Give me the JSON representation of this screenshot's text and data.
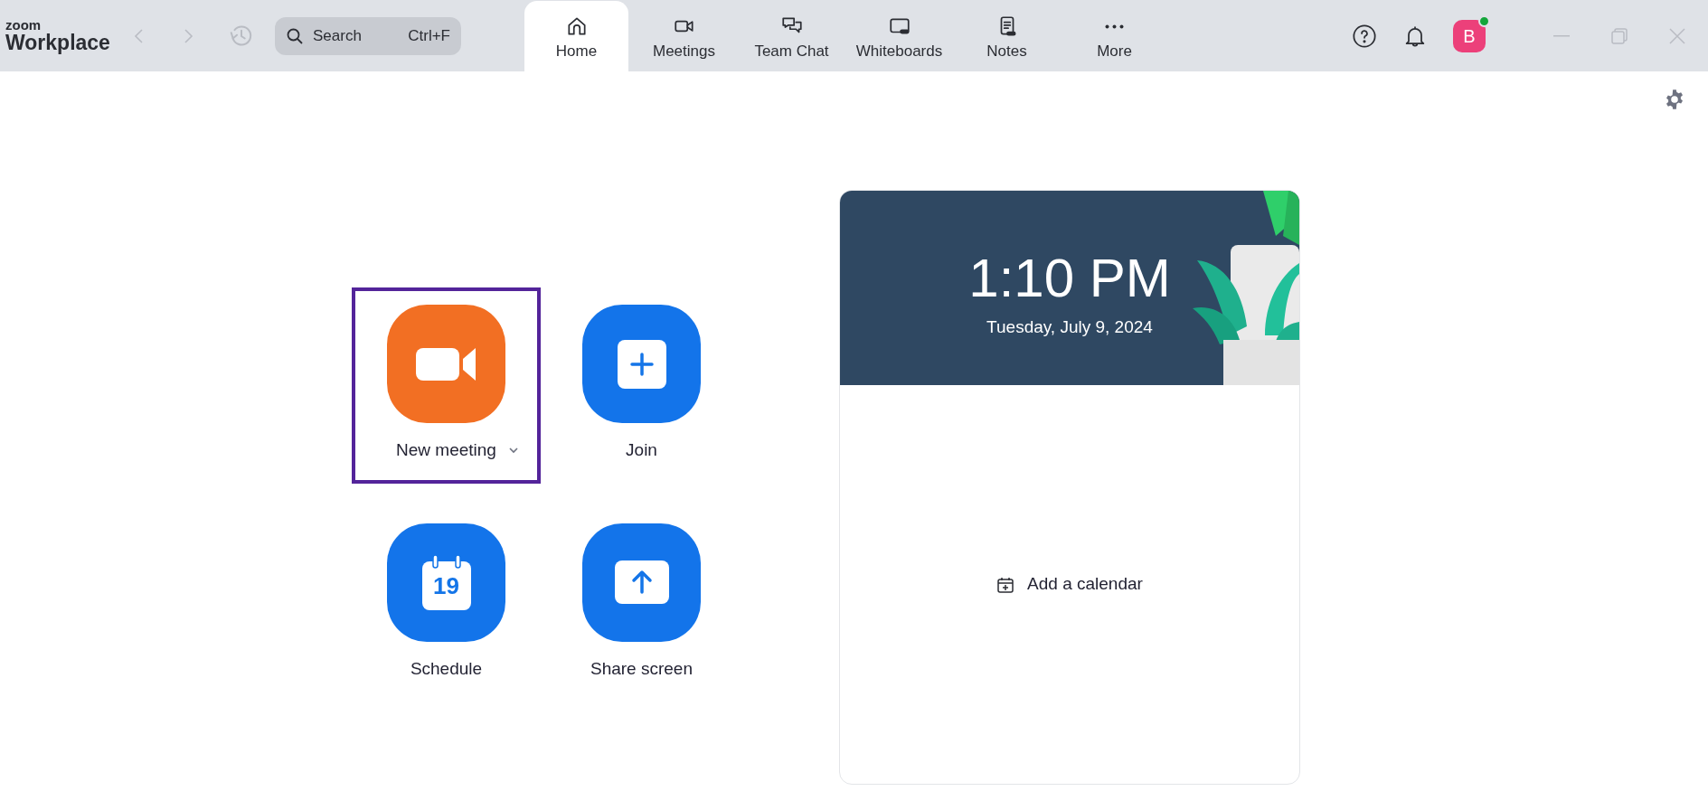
{
  "logo": {
    "brand": "zoom",
    "product": "Workplace"
  },
  "search": {
    "placeholder": "Search",
    "shortcut": "Ctrl+F"
  },
  "tabs": [
    {
      "label": "Home",
      "kind": "home",
      "selected": true
    },
    {
      "label": "Meetings",
      "kind": "video",
      "selected": false
    },
    {
      "label": "Team Chat",
      "kind": "chat",
      "selected": false
    },
    {
      "label": "Whiteboards",
      "kind": "whiteboard",
      "selected": false
    },
    {
      "label": "Notes",
      "kind": "notes",
      "selected": false
    },
    {
      "label": "More",
      "kind": "more",
      "selected": false
    }
  ],
  "avatar": {
    "initial": "B",
    "online": true
  },
  "actions": [
    {
      "label": "New meeting",
      "kind": "video",
      "highlighted": true
    },
    {
      "label": "Join",
      "kind": "join",
      "highlighted": false
    },
    {
      "label": "Schedule",
      "kind": "schedule",
      "highlighted": false,
      "day": "19"
    },
    {
      "label": "Share screen",
      "kind": "share",
      "highlighted": false
    }
  ],
  "clock": {
    "time": "1:10 PM",
    "date": "Tuesday, July 9, 2024"
  },
  "calendar": {
    "link": "Add a calendar"
  }
}
